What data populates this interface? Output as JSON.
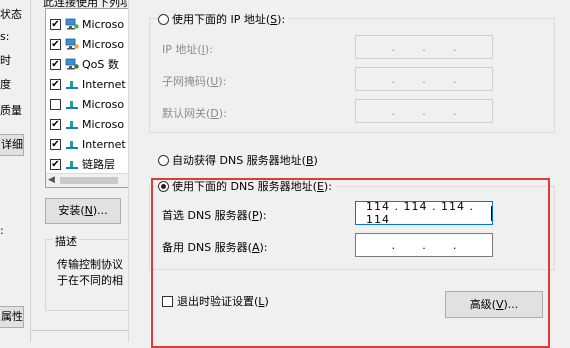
{
  "left_window": {
    "text_1": "状态",
    "text_2": "s:",
    "text_3": "时",
    "text_4": "度",
    "text_5": "质量",
    "button_1": "详细",
    "text_6": ":",
    "text_7": "",
    "button_2": "属性"
  },
  "mid_window": {
    "top_line": "此连接使用下列项",
    "items": [
      {
        "checked": true,
        "label": "Microso",
        "icon": "network-client-icon"
      },
      {
        "checked": true,
        "label": "Microso",
        "icon": "network-client-icon"
      },
      {
        "checked": true,
        "label": "QoS 数",
        "icon": "qos-icon"
      },
      {
        "checked": true,
        "label": "Internet",
        "icon": "protocol-icon"
      },
      {
        "checked": false,
        "label": "Microso",
        "icon": "protocol-icon"
      },
      {
        "checked": true,
        "label": "Microso",
        "icon": "protocol-icon"
      },
      {
        "checked": true,
        "label": "Internet",
        "icon": "protocol-icon"
      },
      {
        "checked": true,
        "label": "链路层",
        "icon": "protocol-icon"
      }
    ],
    "install_button_prefix": "安装(",
    "install_button_key": "N",
    "install_button_suffix": ")...",
    "description_label": "描述",
    "description_line1": "传输控制协议",
    "description_line2": "于在不同的相"
  },
  "dialog": {
    "use_ip_radio_prefix": "使用下面的 IP 地址(",
    "use_ip_radio_key": "S",
    "use_ip_radio_suffix": "):",
    "ip_label_prefix": "IP 地址(",
    "ip_label_key": "I",
    "ip_label_suffix": "):",
    "mask_label_prefix": "子网掩码(",
    "mask_label_key": "U",
    "mask_label_suffix": "):",
    "gateway_label_prefix": "默认网关(",
    "gateway_label_key": "D",
    "gateway_label_suffix": "):",
    "ip_dot": ".",
    "auto_dns_prefix": "自动获得 DNS 服务器地址(",
    "auto_dns_key": "B",
    "auto_dns_suffix": ")",
    "use_dns_prefix": "使用下面的 DNS 服务器地址(",
    "use_dns_key": "E",
    "use_dns_suffix": "):",
    "preferred_dns_prefix": "首选 DNS 服务器(",
    "preferred_dns_key": "P",
    "preferred_dns_suffix": "):",
    "preferred_dns_value": "114 . 114 . 114 . 114",
    "alternate_dns_prefix": "备用 DNS 服务器(",
    "alternate_dns_key": "A",
    "alternate_dns_suffix": "):",
    "validate_prefix": "退出时验证设置(",
    "validate_key": "L",
    "validate_suffix": ")",
    "advanced_prefix": "高级(",
    "advanced_key": "V",
    "advanced_suffix": ")..."
  },
  "colors": {
    "highlight_border": "#e03b3b",
    "focus_border": "#0078d7",
    "window_bg": "#f0f0f0"
  }
}
